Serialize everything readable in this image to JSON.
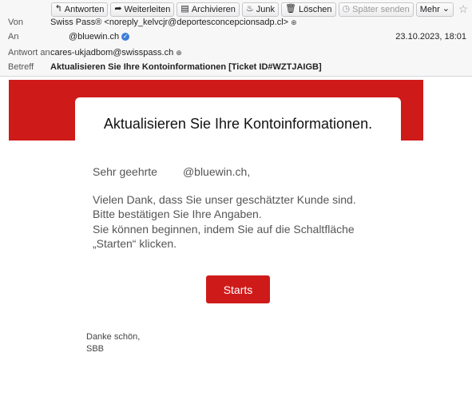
{
  "toolbar": {
    "reply": "Antworten",
    "forward": "Weiterleiten",
    "archive": "Archivieren",
    "junk": "Junk",
    "delete": "Löschen",
    "later": "Später senden",
    "more": "Mehr"
  },
  "header": {
    "from_label": "Von",
    "from_value": "Swiss Pass® <noreply_kelvcjr@deportesconcepcionsadp.cl>",
    "to_label": "An",
    "to_value": "@bluewin.ch",
    "date": "23.10.2023, 18:01",
    "replyto_label": "Antwort an",
    "replyto_value": "cares-ukjadbom@swisspass.ch",
    "subject_label": "Betreff",
    "subject_value": "Aktualisieren Sie Ihre Kontoinformationen [Ticket ID#WZTJAIGB]"
  },
  "email": {
    "title": "Aktualisieren Sie Ihre Kontoinformationen.",
    "greeting_prefix": "Sehr geehrte",
    "greeting_domain": "@bluewin.ch,",
    "paragraph1": "Vielen Dank, dass Sie unser geschätzter Kunde sind. Bitte bestätigen Sie Ihre Angaben.",
    "paragraph2": "Sie können beginnen, indem Sie auf die Schaltfläche „Starten“ klicken.",
    "button": "Starts",
    "sign1": "Danke schön,",
    "sign2": "SBB"
  },
  "colors": {
    "brand_red": "#cf1a1a",
    "header_bg": "#f7f7f8"
  },
  "icons": [
    "reply-icon",
    "forward-icon",
    "archive-icon",
    "junk-icon",
    "trash-icon",
    "clock-icon",
    "chevron-down-icon",
    "star-icon",
    "contact-icon",
    "verified-icon"
  ]
}
